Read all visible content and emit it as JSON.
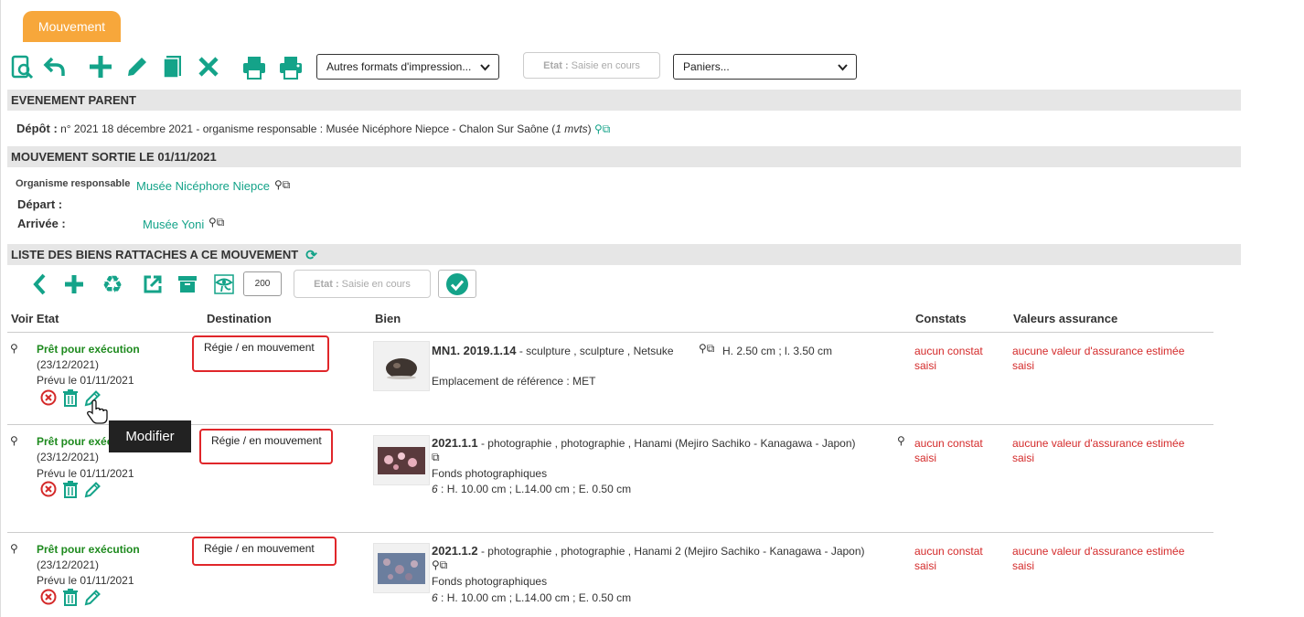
{
  "tab": {
    "label": "Mouvement"
  },
  "toolbar": {
    "print_formats": "Autres formats d'impression...",
    "etat_label": "Etat :",
    "etat_value": "Saisie en cours",
    "paniers": "Paniers..."
  },
  "evenement_parent": {
    "title": "EVENEMENT PARENT",
    "depot_label": "Dépôt :",
    "depot_text": "n° 2021 18 décembre 2021 - organisme responsable : Musée Nicéphore Niepce - Chalon Sur Saône (",
    "depot_mvts": "1 mvts",
    "depot_close": ")"
  },
  "mouvement": {
    "title": "MOUVEMENT SORTIE LE 01/11/2021",
    "organisme_label": "Organisme responsable",
    "organisme_value": "Musée Nicéphore Niepce",
    "depart_label": "Départ :",
    "arrivee_label": "Arrivée :",
    "arrivee_value": "Musée Yoni"
  },
  "liste": {
    "title": "LISTE DES BIENS RATTACHES A CE MOUVEMENT",
    "qty": "200",
    "etat_label": "Etat :",
    "etat_value": "Saisie en cours"
  },
  "columns": {
    "voir_etat": "Voir Etat",
    "destination": "Destination",
    "bien": "Bien",
    "constats": "Constats",
    "valeurs": "Valeurs assurance"
  },
  "rows": [
    {
      "status": "Prêt pour exécution",
      "date": "(23/12/2021)",
      "prevu": "Prévu le 01/11/2021",
      "destination": "Régie / en mouvement",
      "bien_id": "MN1. 2019.1.14",
      "bien_desc": " - sculpture , sculpture , Netsuke",
      "dims": "H. 2.50 cm ; l. 3.50 cm",
      "line2": "Emplacement de référence : MET",
      "line3_prefix": "",
      "line3": "",
      "constat": "aucun constat saisi",
      "valeur": "aucune valeur d'assurance estimée saisi"
    },
    {
      "status": "Prêt pour exécution",
      "date": "(23/12/2021)",
      "prevu": "Prévu le 01/11/2021",
      "destination": "Régie / en mouvement",
      "bien_id": "2021.1.1",
      "bien_desc": " - photographie , photographie , Hanami (Mejiro Sachiko - Kanagawa - Japon)",
      "dims": "",
      "line2": "Fonds photographiques",
      "line3_prefix": "6",
      "line3": " : H. 10.00 cm ; L.14.00 cm ; E. 0.50 cm",
      "constat": "aucun constat saisi",
      "valeur": "aucune valeur d'assurance estimée saisi"
    },
    {
      "status": "Prêt pour exécution",
      "date": "(23/12/2021)",
      "prevu": "Prévu le 01/11/2021",
      "destination": "Régie / en mouvement",
      "bien_id": "2021.1.2",
      "bien_desc": " - photographie , photographie , Hanami 2 (Mejiro Sachiko - Kanagawa - Japon)",
      "dims": "",
      "line2": "Fonds photographiques",
      "line3_prefix": "6",
      "line3": " : H. 10.00 cm ; L.14.00 cm ; E. 0.50 cm",
      "constat": "aucun constat saisi",
      "valeur": "aucune valeur d'assurance estimée saisi"
    }
  ],
  "tooltip": "Modifier",
  "colors": {
    "accent": "#14a389",
    "tab": "#f7a73b",
    "status_green": "#1e8a1e",
    "alert_red": "#d42a2a"
  }
}
